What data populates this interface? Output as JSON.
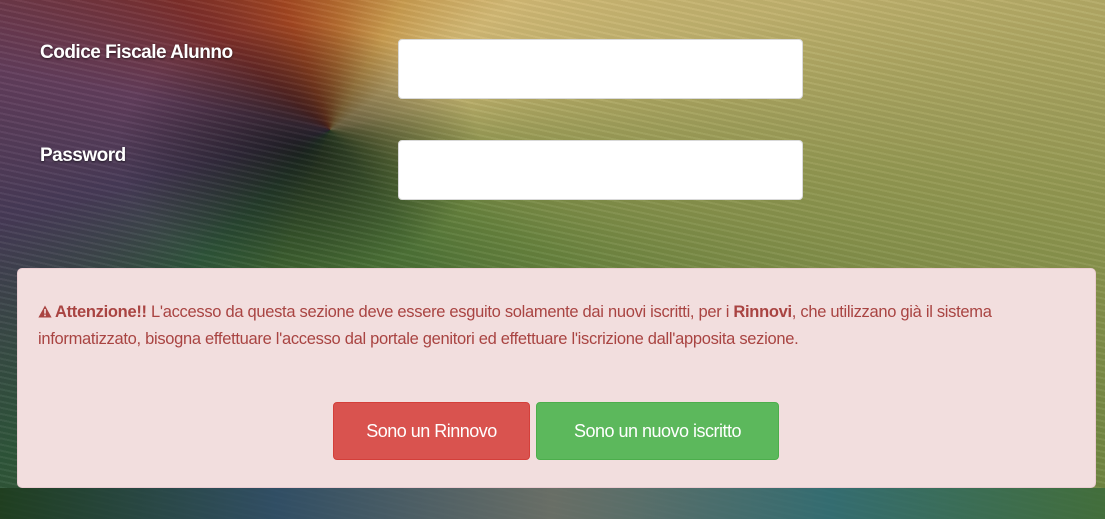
{
  "form": {
    "codice_fiscale_label": "Codice Fiscale Alunno",
    "codice_fiscale_value": "",
    "password_label": "Password",
    "password_value": ""
  },
  "alert": {
    "icon": "warning-triangle-icon",
    "title": "Attenzione!!",
    "text_part1": " L'accesso da questa sezione deve essere esguito solamente dai nuovi iscritti, per i ",
    "highlight": "Rinnovi",
    "text_part2": ", che utilizzano già il sistema informatizzato, bisogna effettuare l'accesso dal portale genitori ed effettuare l'iscrizione dall'apposita sezione.",
    "color": "#a94442",
    "background": "#f2dede"
  },
  "buttons": {
    "renew_label": "Sono un Rinnovo",
    "renew_color": "#d9534f",
    "new_label": "Sono un nuovo iscritto",
    "new_color": "#5cb85c"
  }
}
